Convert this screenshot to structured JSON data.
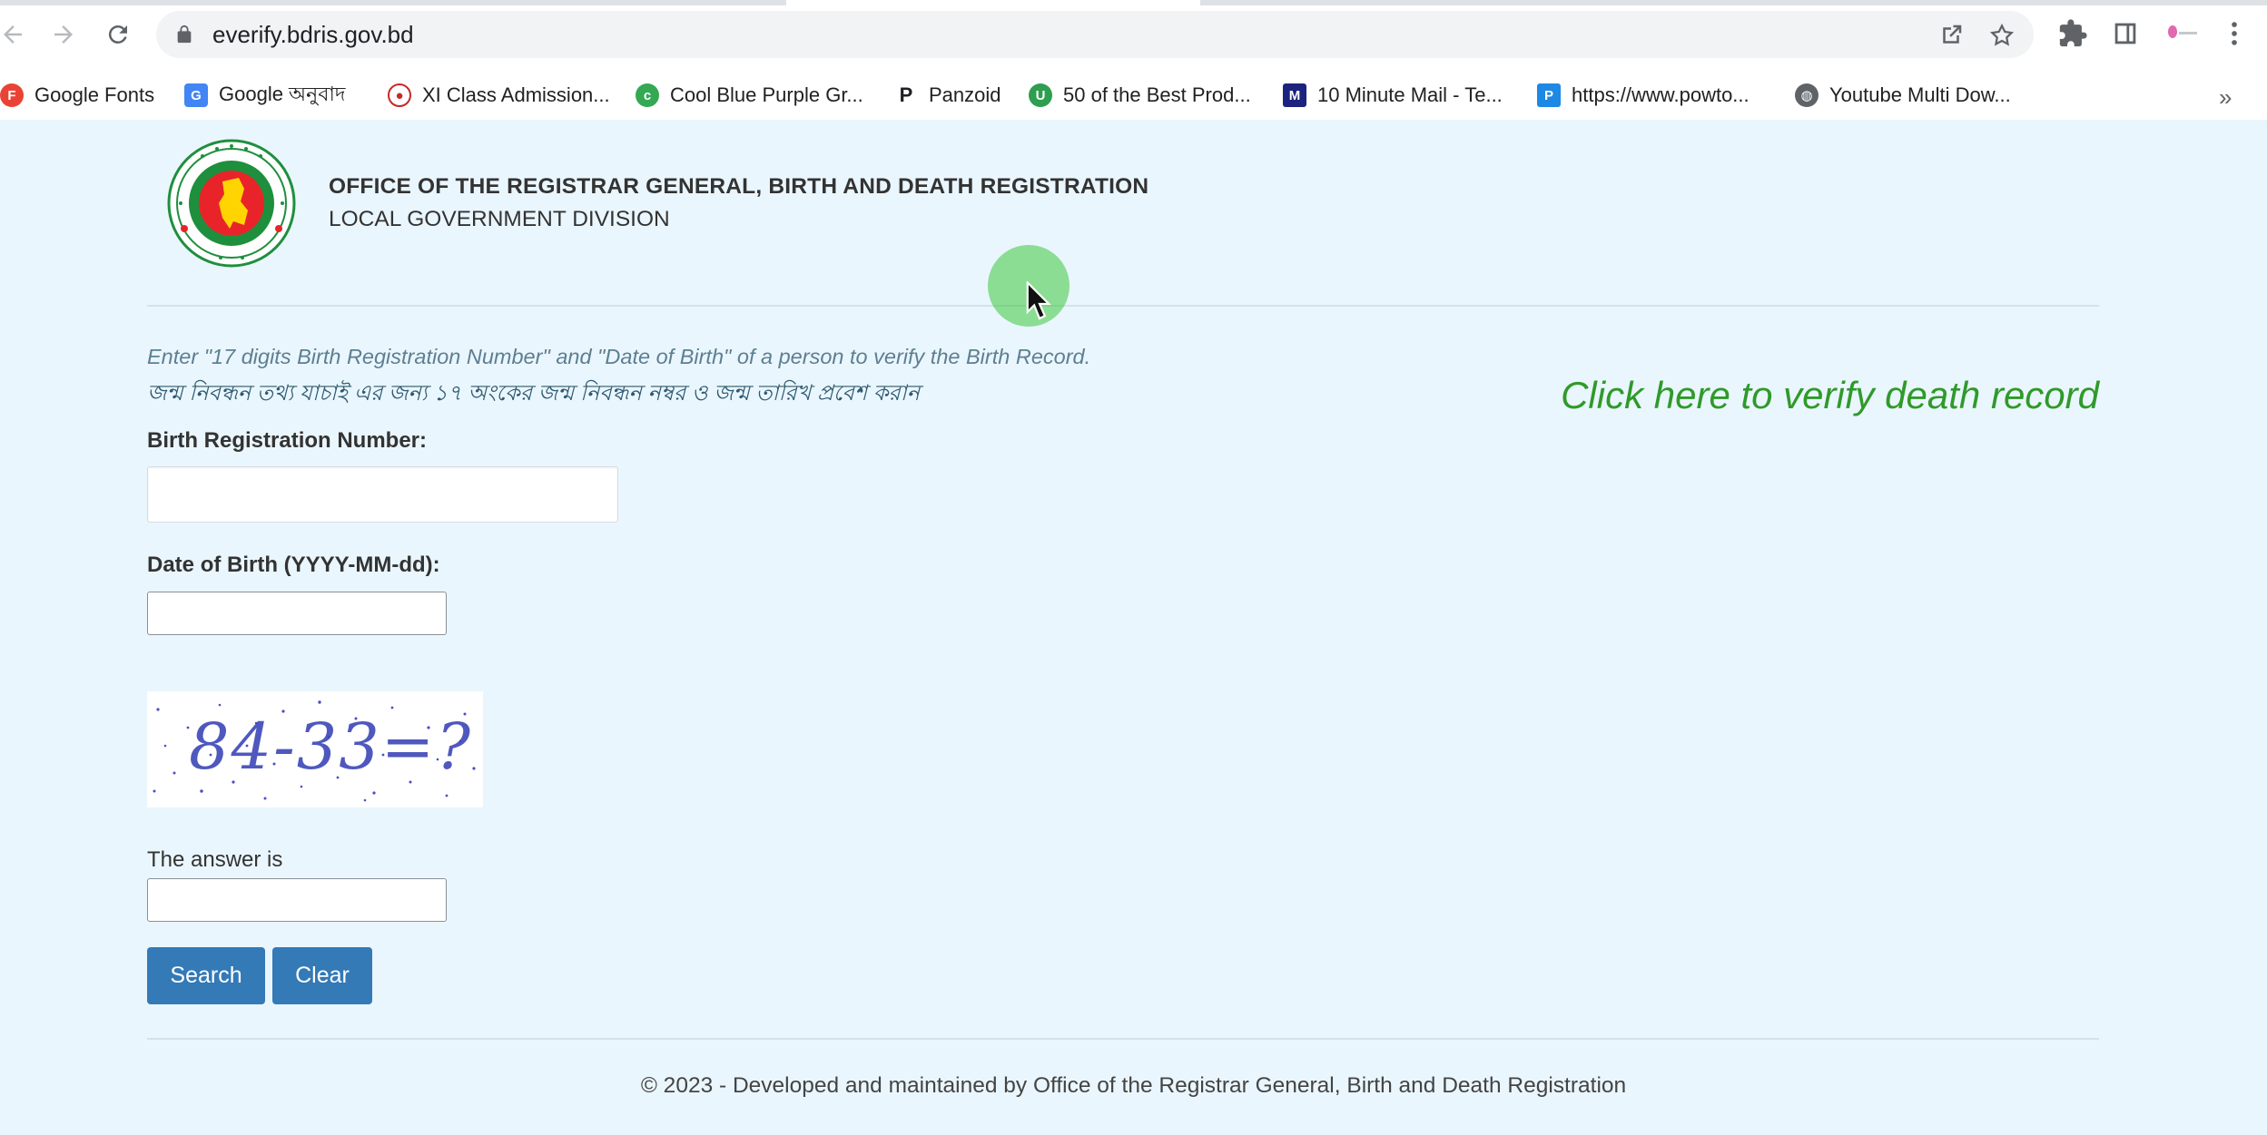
{
  "browser": {
    "url": "everify.bdris.gov.bd",
    "bookmarks": [
      {
        "label": "Google Fonts",
        "icon": "google-fonts-icon",
        "color": "#ea4335",
        "glyph": "F"
      },
      {
        "label": "Google অনুবাদ",
        "icon": "google-translate-icon",
        "color": "#4285f4",
        "glyph": "G"
      },
      {
        "label": "XI Class Admission...",
        "icon": "bd-govt-icon",
        "color": "#c62828",
        "glyph": "●"
      },
      {
        "label": "Cool Blue Purple Gr...",
        "icon": "gradient-icon",
        "color": "#34a853",
        "glyph": "c"
      },
      {
        "label": "Panzoid",
        "icon": "panzoid-icon",
        "color": "#202124",
        "glyph": "P"
      },
      {
        "label": "50 of the Best Prod...",
        "icon": "ub-icon",
        "color": "#2e9e50",
        "glyph": "U"
      },
      {
        "label": "10 Minute Mail - Te...",
        "icon": "ten-minute-mail-icon",
        "color": "#1a237e",
        "glyph": "M"
      },
      {
        "label": "https://www.powto...",
        "icon": "powtoon-icon",
        "color": "#1e88e5",
        "glyph": "P"
      },
      {
        "label": "Youtube Multi Dow...",
        "icon": "globe-icon",
        "color": "#5f6368",
        "glyph": "◍"
      }
    ],
    "more": "»"
  },
  "header": {
    "title": "OFFICE OF THE REGISTRAR GENERAL, BIRTH AND DEATH REGISTRATION",
    "subtitle": "LOCAL GOVERNMENT DIVISION"
  },
  "instructions": {
    "english": "Enter \"17 digits Birth Registration Number\" and \"Date of Birth\" of a person to verify the Birth Record.",
    "bangla": "জন্ম নিবন্ধন তথ্য যাচাই এর জন্য ১৭ অংকের জন্ম নিবন্ধন নম্বর ও জন্ম তারিখ প্রবেশ করান"
  },
  "death_link": "Click here to verify death record",
  "form": {
    "brn_label": "Birth Registration Number:",
    "brn_value": "",
    "dob_label": "Date of Birth (YYYY-MM-dd):",
    "dob_value": "",
    "captcha_text": "84-33=?",
    "answer_label": "The answer is",
    "answer_value": "",
    "search_label": "Search",
    "clear_label": "Clear"
  },
  "footer": "© 2023 - Developed and maintained by Office of the Registrar General, Birth and Death Registration",
  "colors": {
    "page_bg": "#eaf6fd",
    "button": "#337ab7",
    "death_link": "#2f9a2a"
  }
}
